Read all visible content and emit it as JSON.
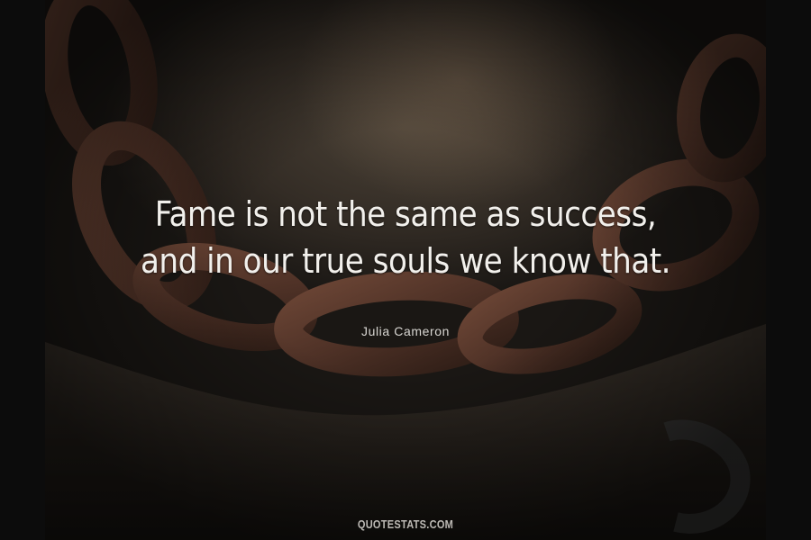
{
  "quote": {
    "line1": "Fame is not the same as success,",
    "line2": "and in our true souls we know that."
  },
  "author": "Julia Cameron",
  "watermark": "QUOTESTATS.COM",
  "colors": {
    "text": "#f2f0ec",
    "background": "#0c0c0c",
    "chain": "#5a3a2c"
  }
}
